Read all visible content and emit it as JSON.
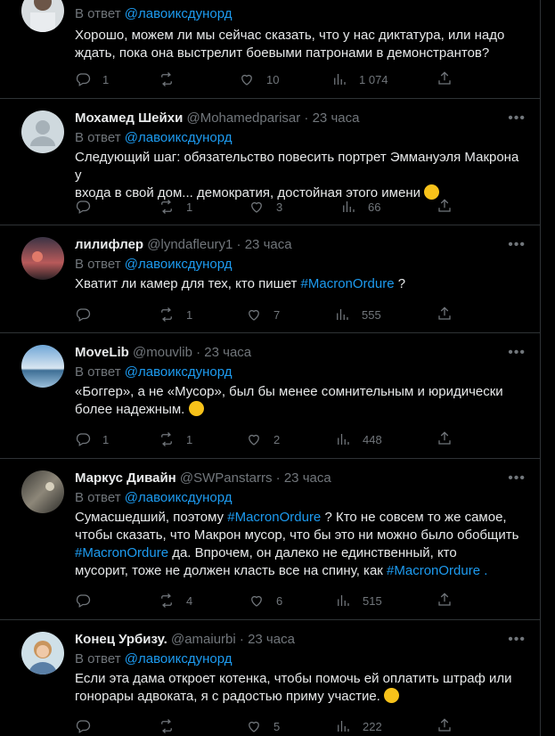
{
  "colors": {
    "accent": "#1d9bf0",
    "muted": "#71767b",
    "text": "#e7e9ea",
    "border": "#2f3336"
  },
  "reply_prefix": "В ответ",
  "tweets": [
    {
      "reply_to": "@лавоиксдунорд",
      "lines": [
        "Хорошо, можем ли мы сейчас сказать, что у нас диктатура, или надо",
        "ждать, пока она выстрелит боевыми патронами в демонстрантов?"
      ],
      "stats": {
        "replies": "1",
        "reposts": "",
        "likes": "10",
        "views": "1 074"
      }
    },
    {
      "name": "Мохамед Шейхи",
      "handle": "@Mohamedparisar",
      "time": "23 часа",
      "reply_to": "@лавоиксдунорд",
      "lines": [
        "Следующий шаг: обязательство повесить портрет Эммануэля Макрона у",
        "входа в свой дом... демократия, достойная этого имени"
      ],
      "stats": {
        "replies": "",
        "reposts": "1",
        "likes": "3",
        "views": "66"
      }
    },
    {
      "name": "лилифлер",
      "handle": "@lyndafleury1",
      "time": "23 часа",
      "reply_to": "@лавоиксдунорд",
      "text_before": "Хватит ли камер для тех, кто пишет ",
      "hashtag": "#MacronOrdure",
      "text_after": " ?",
      "stats": {
        "replies": "",
        "reposts": "1",
        "likes": "7",
        "views": "555"
      }
    },
    {
      "name": "MoveLib",
      "handle": "@mouvlib",
      "time": "23 часа",
      "reply_to": "@лавоиксдунорд",
      "lines": [
        "«Боггер», а не «Мусор», был бы менее сомнительным и юридически",
        "более надежным."
      ],
      "stats": {
        "replies": "1",
        "reposts": "1",
        "likes": "2",
        "views": "448"
      }
    },
    {
      "name": "Маркус Дивайн",
      "handle": "@SWPanstarrs",
      "time": "23 часа",
      "reply_to": "@лавоиксдунорд",
      "l1a": "Сумасшедший, поэтому ",
      "l1tag": "#MacronOrdure",
      "l1b": " ?   Кто не совсем то же самое,",
      "l2": "чтобы сказать, что Макрон мусор, что бы это ни можно было обобщить",
      "l3tag": "#MacronOrdure",
      "l3b": " да.   Впрочем, он далеко не единственный, кто",
      "l4a": "мусорит, тоже не должен класть все на спину, как ",
      "l4tag": "#MacronOrdure",
      "l4b": " .",
      "stats": {
        "replies": "",
        "reposts": "4",
        "likes": "6",
        "views": "515"
      }
    },
    {
      "name": "Конец Урбизу.",
      "handle": "@amaiurbi",
      "time": "23 часа",
      "reply_to": "@лавоиксдунорд",
      "lines": [
        "Если эта дама откроет котенка, чтобы помочь ей оплатить штраф или",
        "гонорары адвоката, я с радостью приму участие."
      ],
      "stats": {
        "replies": "",
        "reposts": "",
        "likes": "5",
        "views": "222"
      }
    }
  ]
}
